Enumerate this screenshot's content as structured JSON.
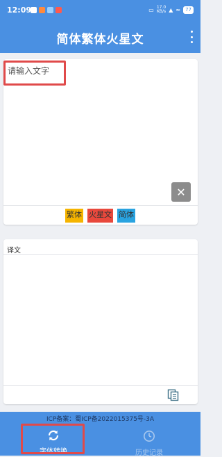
{
  "status_bar": {
    "time": "12:09",
    "speed_value": "17.0",
    "speed_unit": "KB/s",
    "battery": "77"
  },
  "app_bar": {
    "title": "简体繁体火星文"
  },
  "input": {
    "placeholder": "请输入文字",
    "value": ""
  },
  "modes": [
    {
      "label": "繁体",
      "color": "#f5b400"
    },
    {
      "label": "火星文",
      "color": "#e8483c"
    },
    {
      "label": "简体",
      "color": "#29a3e0"
    }
  ],
  "result": {
    "label": "译文",
    "text": ""
  },
  "footer": {
    "icp": "ICP备案：蜀ICP备2022015375号-3A",
    "tabs": [
      {
        "label": "字体转换",
        "active": true
      },
      {
        "label": "历史记录",
        "active": false
      }
    ]
  },
  "colors": {
    "primary": "#4a90e2",
    "annotation": "#e04a4a"
  }
}
